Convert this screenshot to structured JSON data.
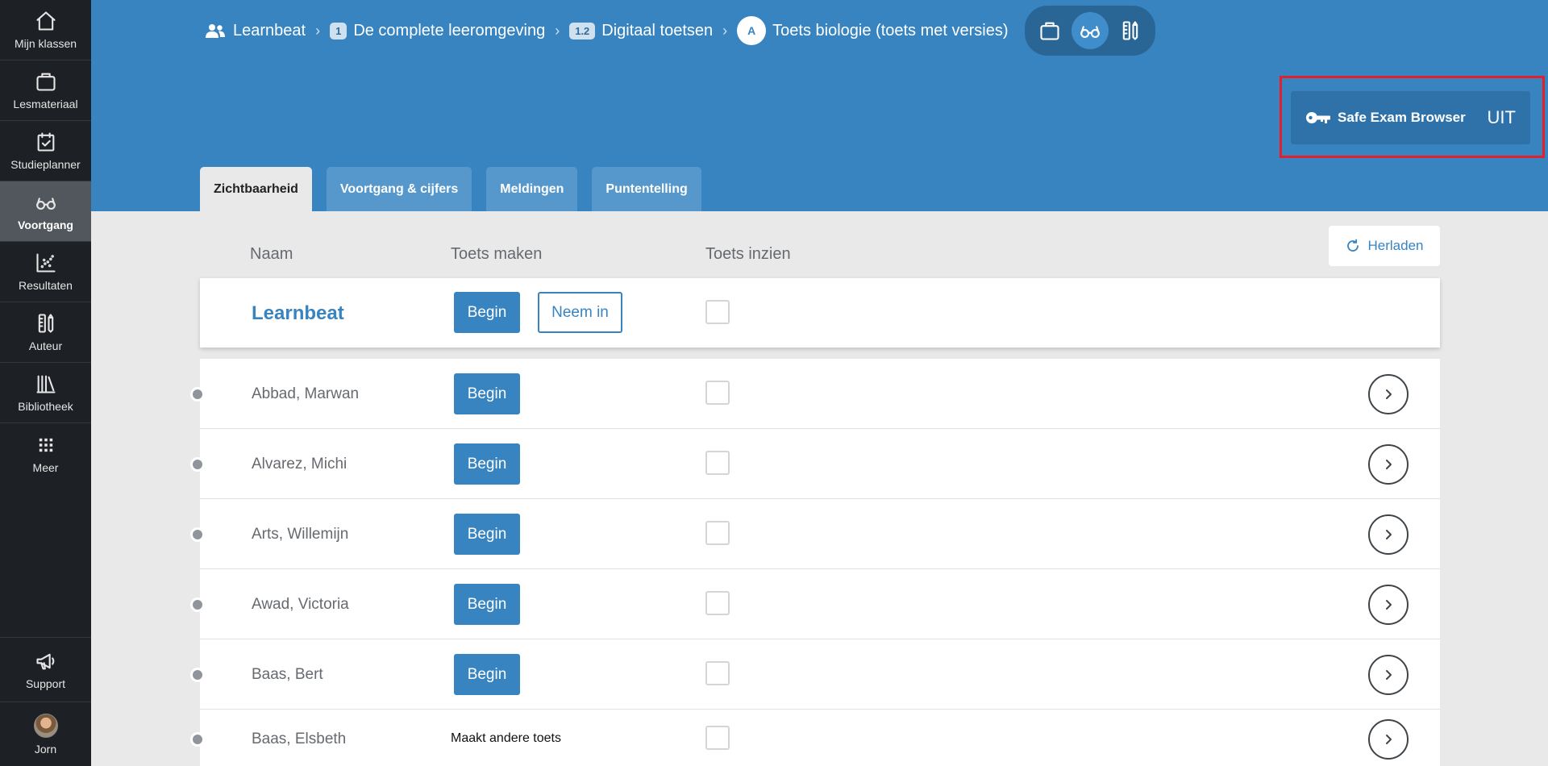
{
  "sidebar": {
    "items": [
      {
        "label": "Mijn klassen",
        "icon": "home-icon"
      },
      {
        "label": "Lesmateriaal",
        "icon": "briefcase-icon"
      },
      {
        "label": "Studieplanner",
        "icon": "calendar-check-icon"
      },
      {
        "label": "Voortgang",
        "icon": "glasses-icon",
        "active": true
      },
      {
        "label": "Resultaten",
        "icon": "scatter-chart-icon"
      },
      {
        "label": "Auteur",
        "icon": "pencil-ruler-icon"
      },
      {
        "label": "Bibliotheek",
        "icon": "books-icon"
      },
      {
        "label": "Meer",
        "icon": "grid-icon"
      }
    ],
    "support_label": "Support",
    "user_label": "Jorn"
  },
  "breadcrumb": {
    "org": "Learnbeat",
    "course_num": "1",
    "course": "De complete leeromgeving",
    "chapter_num": "1.2",
    "chapter": "Digitaal toetsen",
    "item_badge": "A",
    "item": "Toets biologie (toets met versies)"
  },
  "seb": {
    "label": "Safe Exam Browser",
    "state": "UIT",
    "highlight_color": "#e2202c"
  },
  "tabs": [
    "Zichtbaarheid",
    "Voortgang & cijfers",
    "Meldingen",
    "Puntentelling"
  ],
  "table": {
    "headers": {
      "name": "Naam",
      "make": "Toets maken",
      "review": "Toets inzien"
    },
    "reload_label": "Herladen",
    "class_row": {
      "name": "Learnbeat",
      "begin": "Begin",
      "take_in": "Neem in"
    },
    "students": [
      {
        "name": "Abbad, Marwan",
        "action": "Begin"
      },
      {
        "name": "Alvarez, Michi",
        "action": "Begin"
      },
      {
        "name": "Arts, Willemijn",
        "action": "Begin"
      },
      {
        "name": "Awad, Victoria",
        "action": "Begin"
      },
      {
        "name": "Baas, Bert",
        "action": "Begin"
      },
      {
        "name": "Baas, Elsbeth",
        "other_test": "Maakt andere toets"
      }
    ]
  },
  "colors": {
    "primary": "#3784c1",
    "sidebar_bg": "#1d2024",
    "content_bg": "#e9e9e9"
  }
}
